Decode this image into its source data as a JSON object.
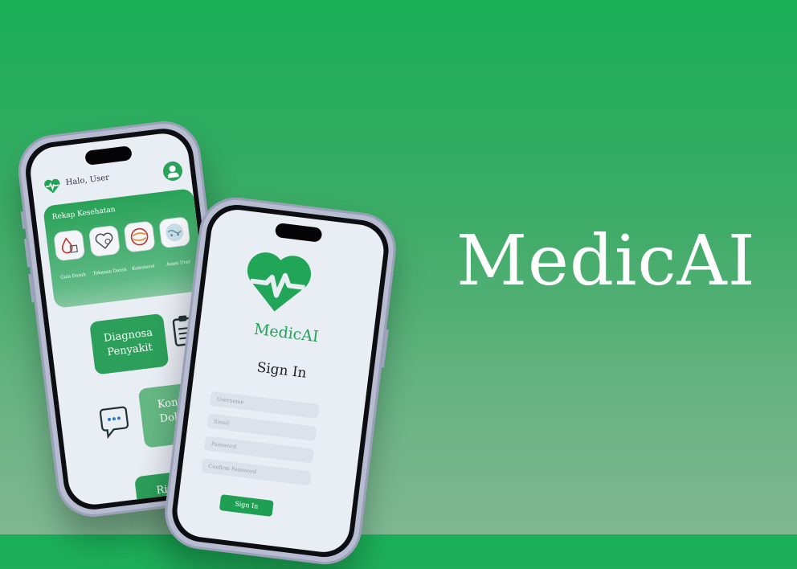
{
  "hero": {
    "title": "MedicAI"
  },
  "home_screen": {
    "greeting": "Halo, User",
    "rekap_title": "Rekap Kesehatan",
    "metrics": [
      {
        "label": "Gula Darah",
        "icon": "blood-drop-icon"
      },
      {
        "label": "Tekanan Darah",
        "icon": "heart-pressure-icon"
      },
      {
        "label": "Kolesterol",
        "icon": "cholesterol-icon"
      },
      {
        "label": "Asam Urat",
        "icon": "uric-acid-icon"
      }
    ],
    "menu": {
      "diagnosa": "Diagnosa Penyakit",
      "kontak": "Kontak Dokter",
      "riwayat": "Riwayat Diagnosa"
    }
  },
  "signin_screen": {
    "app_name": "MedicAI",
    "title": "Sign In",
    "fields": {
      "username": "Username",
      "email": "Email",
      "password": "Password",
      "confirm_password": "Confirm Password"
    },
    "button": "Sign In"
  },
  "colors": {
    "brand_green": "#1fa556",
    "background_top": "#1aaf58",
    "background_bottom": "#7fb792"
  }
}
